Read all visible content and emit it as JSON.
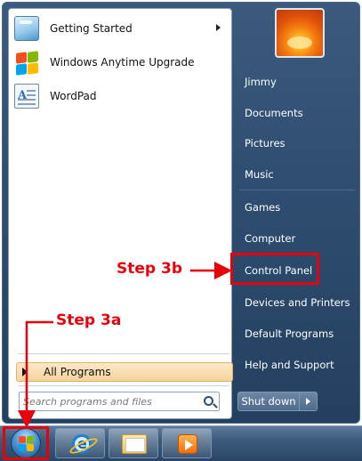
{
  "start_menu": {
    "programs": [
      {
        "label": "Getting Started",
        "icon": "getting-started-icon",
        "has_submenu": true
      },
      {
        "label": "Windows Anytime Upgrade",
        "icon": "windows-logo-icon",
        "has_submenu": false
      },
      {
        "label": "WordPad",
        "icon": "wordpad-icon",
        "has_submenu": false
      }
    ],
    "all_programs_label": "All Programs",
    "search_placeholder": "Search programs and files",
    "right_links": [
      "Jimmy",
      "Documents",
      "Pictures",
      "Music",
      "Games",
      "Computer",
      "Control Panel",
      "Devices and Printers",
      "Default Programs",
      "Help and Support"
    ],
    "shutdown_label": "Shut down"
  },
  "taskbar": {
    "items": [
      "start-orb-icon",
      "internet-explorer-icon",
      "windows-explorer-icon",
      "media-player-icon"
    ]
  },
  "annotations": {
    "step_3a": "Step 3a",
    "step_3b": "Step 3b",
    "color": "#e8000b"
  }
}
